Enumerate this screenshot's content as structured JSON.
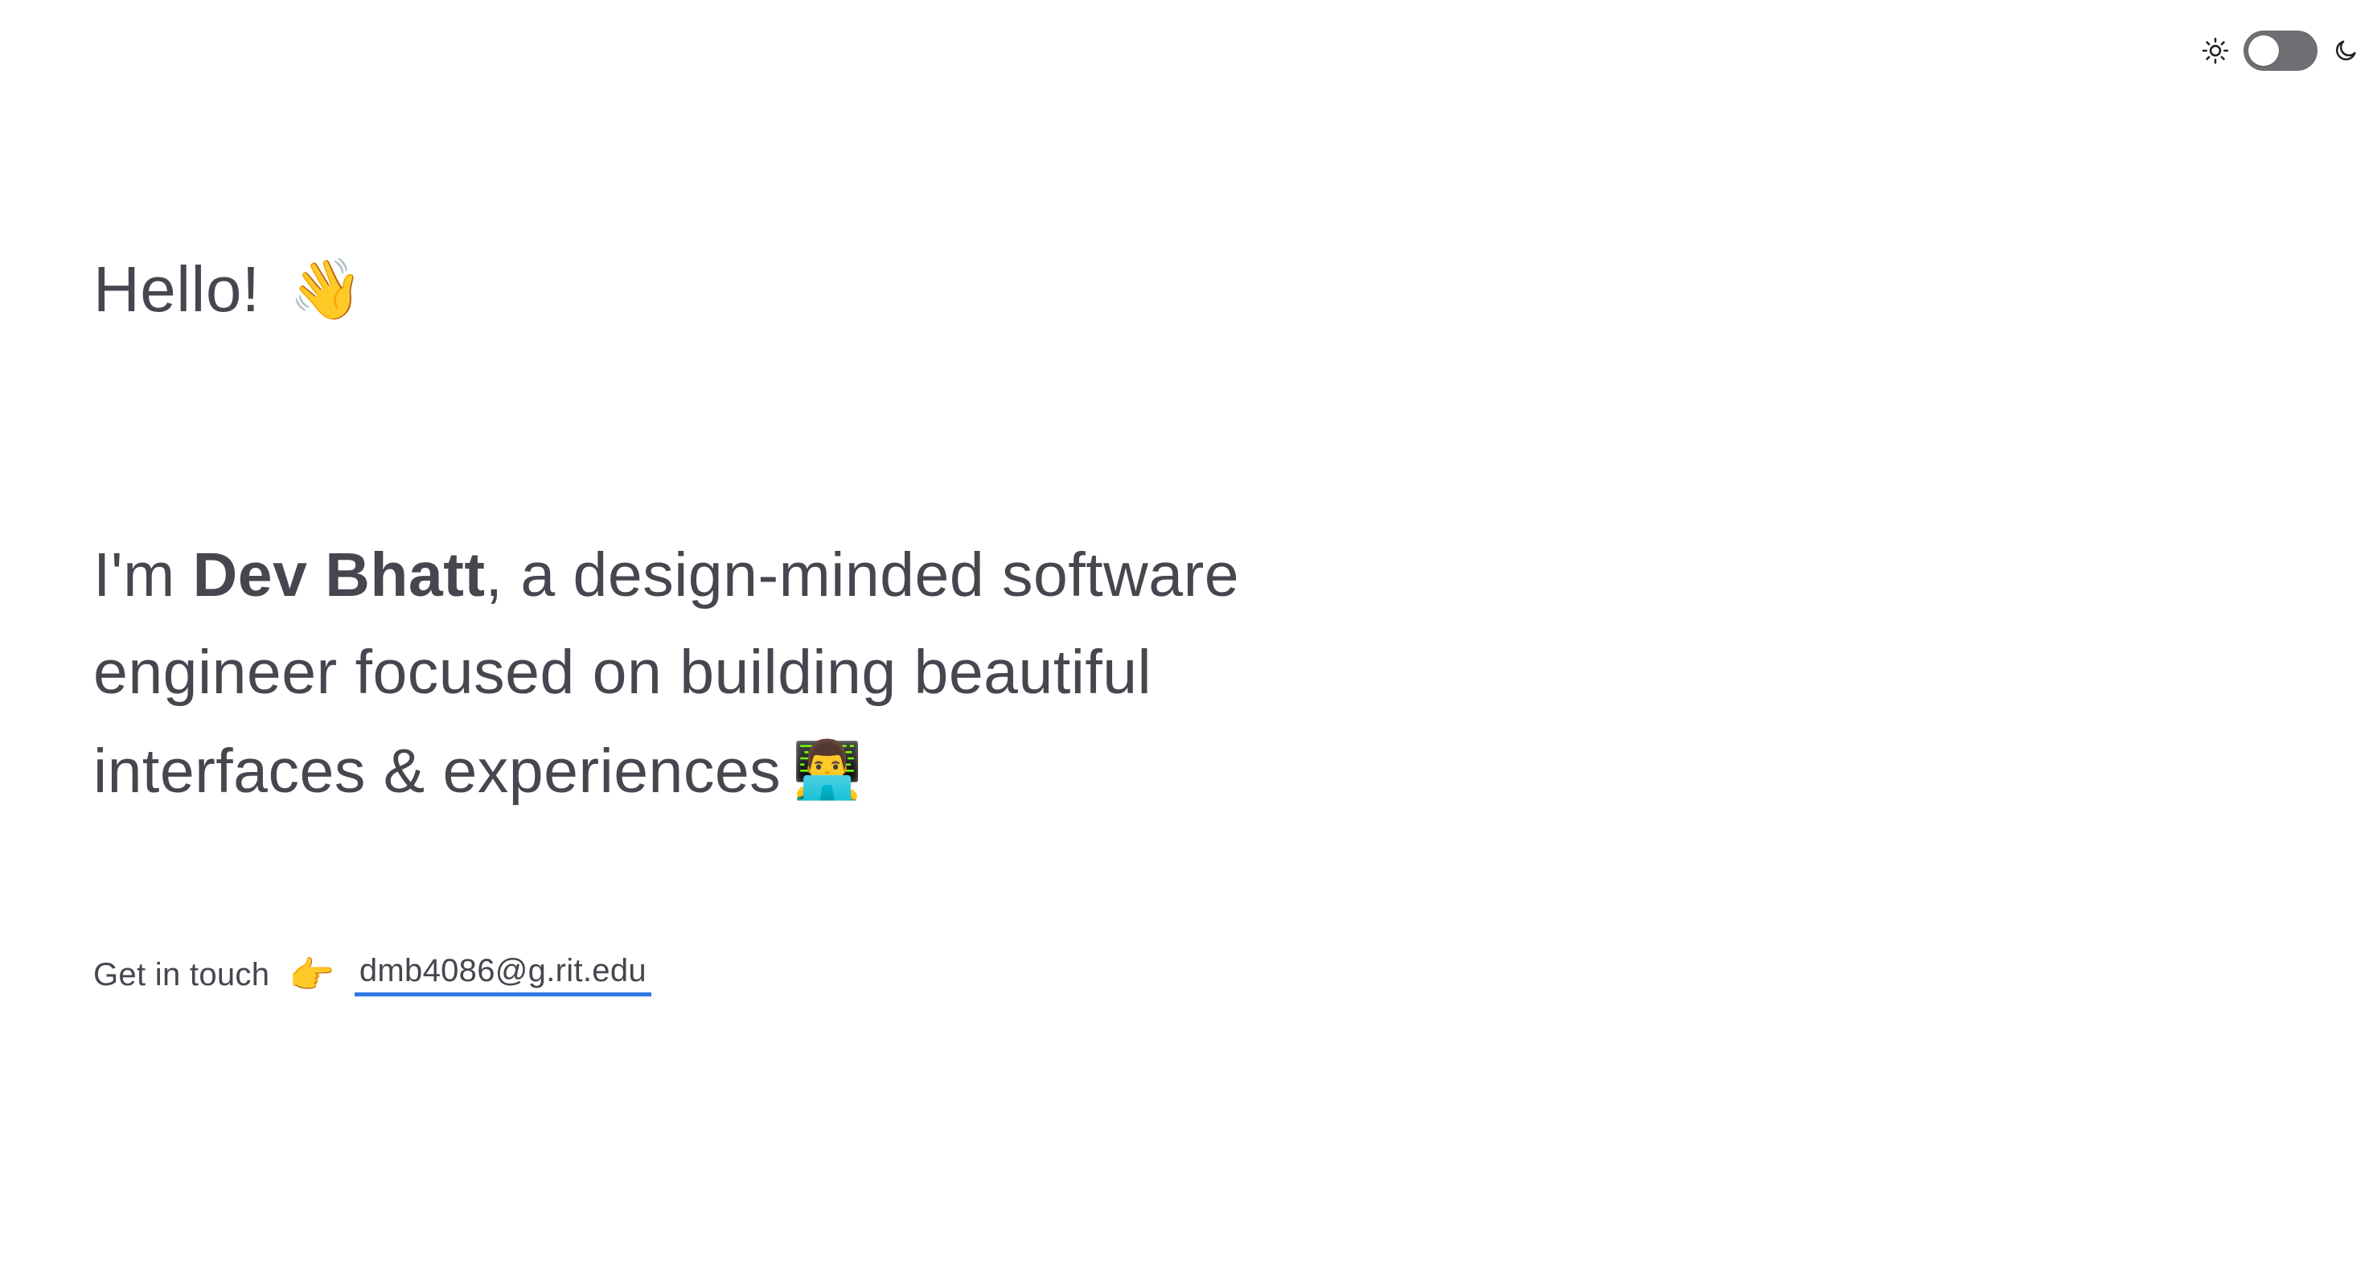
{
  "header": {
    "theme_toggle": {
      "left_icon": "sun-icon",
      "right_icon": "moon-icon",
      "state": "light",
      "track_color": "#6f6f73",
      "knob_color": "#ffffff"
    }
  },
  "hero": {
    "greeting": "Hello!",
    "greeting_emoji": "👋",
    "intro_prefix": "I'm ",
    "name": "Dev Bhatt",
    "intro_suffix": ", a design-minded software engineer focused on building beautiful interfaces & experiences",
    "intro_emoji": "👨‍💻"
  },
  "contact": {
    "label": "Get in touch",
    "emoji": "👉",
    "email": "dmb4086@g.rit.edu",
    "underline_color": "#2f7ae5"
  },
  "colors": {
    "text": "#46464f",
    "background": "#ffffff",
    "accent": "#2f7ae5"
  }
}
